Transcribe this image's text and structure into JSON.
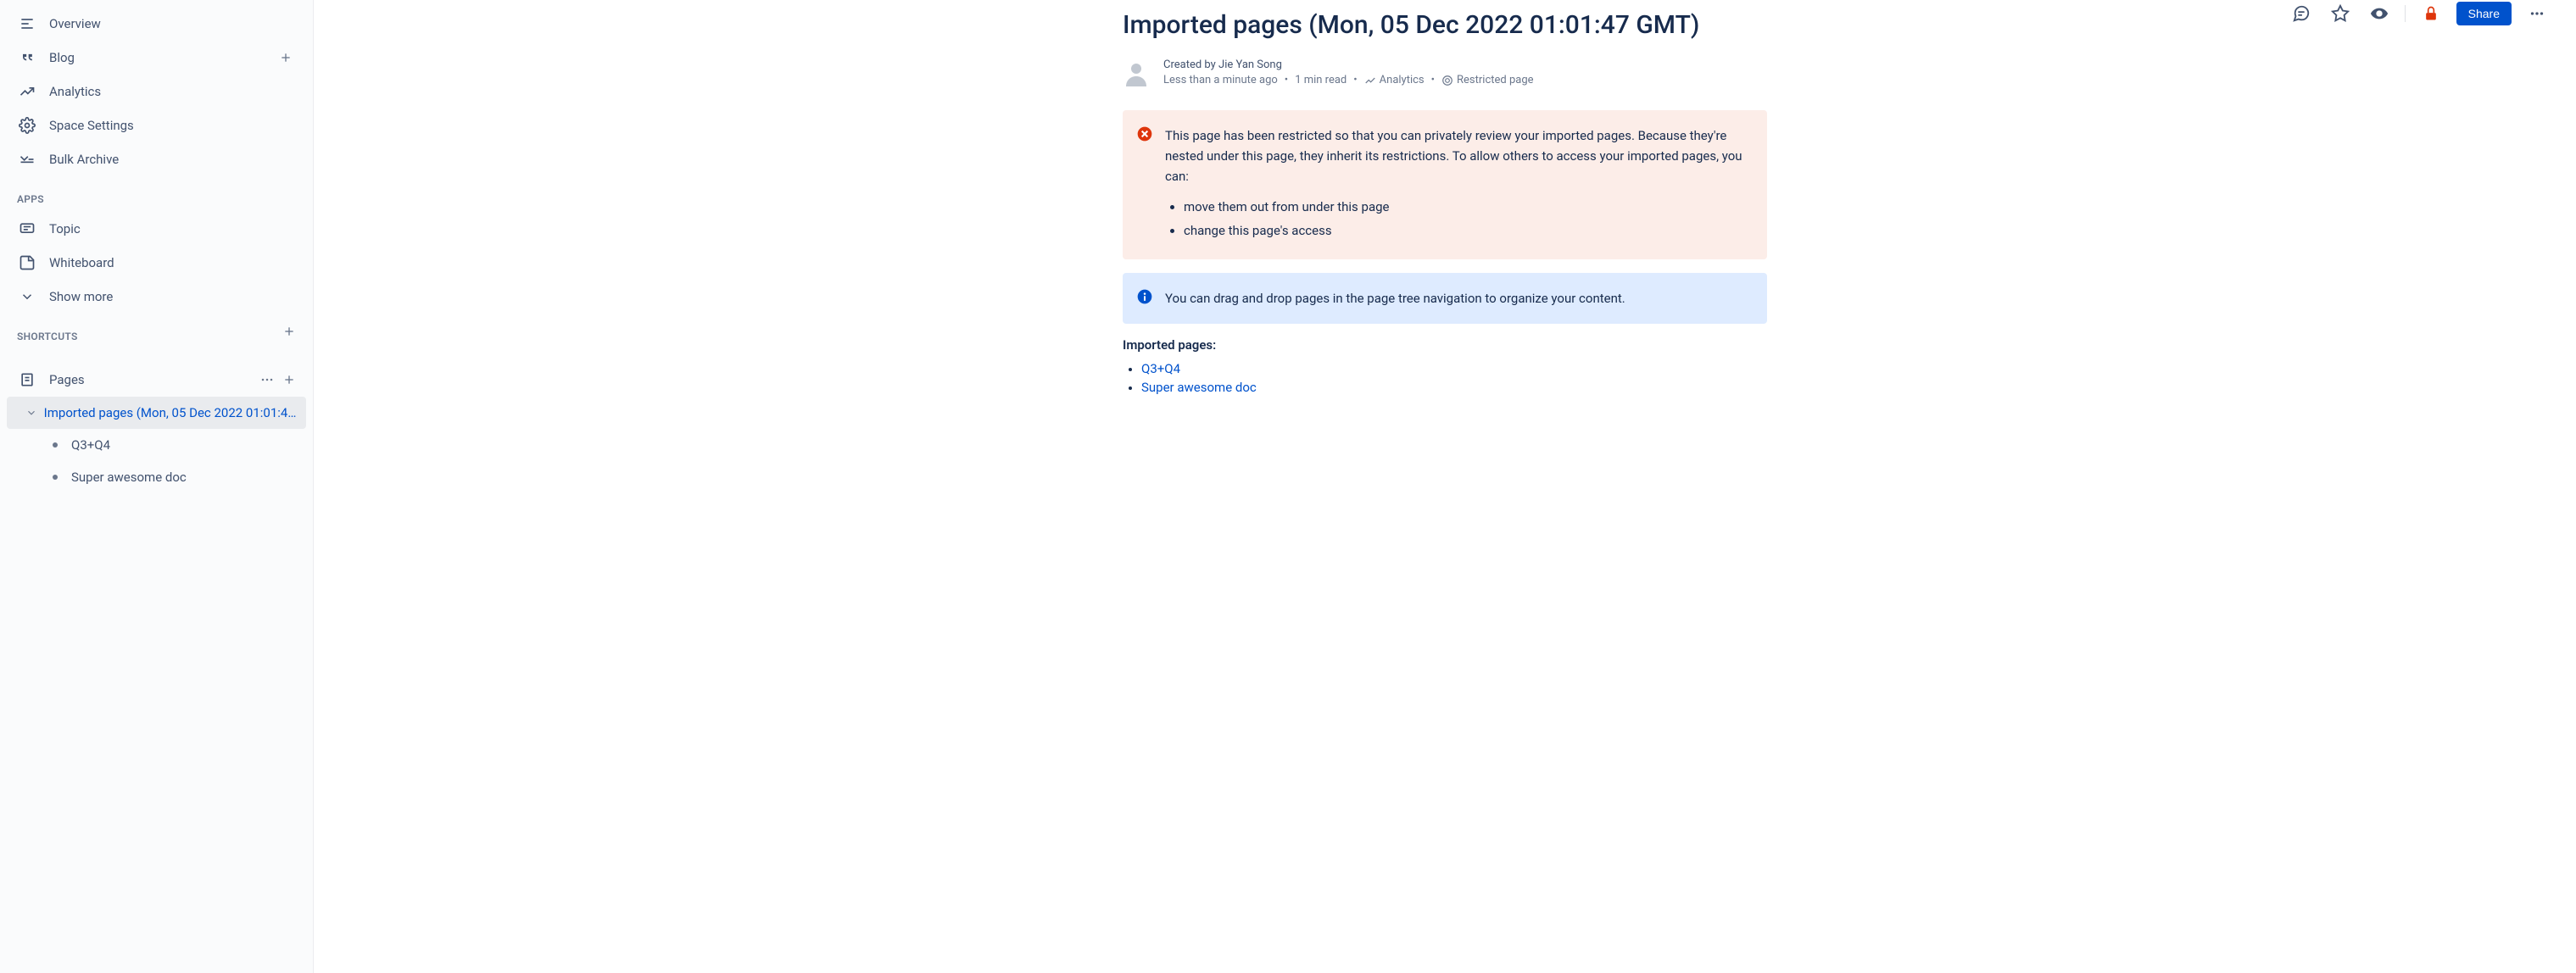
{
  "sidebar": {
    "nav": [
      {
        "label": "Overview"
      },
      {
        "label": "Blog"
      },
      {
        "label": "Analytics"
      },
      {
        "label": "Space Settings"
      },
      {
        "label": "Bulk Archive"
      }
    ],
    "apps_header": "APPS",
    "apps": [
      {
        "label": "Topic"
      },
      {
        "label": "Whiteboard"
      },
      {
        "label": "Show more"
      }
    ],
    "shortcuts_header": "SHORTCUTS",
    "pages_label": "Pages",
    "tree": {
      "root": "Imported pages (Mon, 05 Dec 2022 01:01:47…",
      "children": [
        {
          "label": "Q3+Q4"
        },
        {
          "label": "Super awesome doc"
        }
      ]
    }
  },
  "toolbar": {
    "share_label": "Share"
  },
  "page": {
    "title": "Imported pages (Mon, 05 Dec 2022 01:01:47 GMT)",
    "created_by_prefix": "Created by ",
    "author": "Jie Yan Song",
    "time_ago": "Less than a minute ago",
    "read_time": "1 min read",
    "analytics_label": "Analytics",
    "restricted_label": "Restricted page",
    "warning_text": "This page has been restricted so that you can privately review your imported pages. Because they're nested under this page, they inherit its restrictions. To allow others to access your imported pages, you can:",
    "warning_bullets": [
      "move them out from under this page",
      "change this page's access"
    ],
    "info_text": "You can drag and drop pages in the page tree navigation to organize your content.",
    "imported_label": "Imported pages:",
    "imported_links": [
      {
        "label": "Q3+Q4"
      },
      {
        "label": "Super awesome doc"
      }
    ]
  }
}
